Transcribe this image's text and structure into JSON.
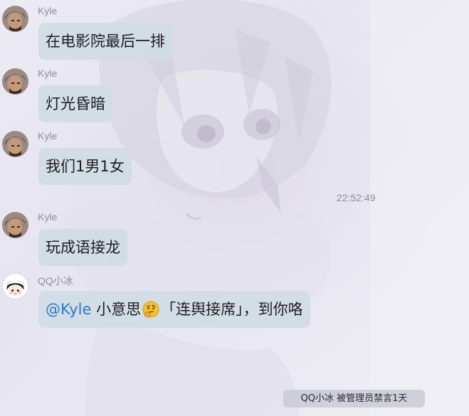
{
  "messages": [
    {
      "sender": "Kyle",
      "text": "在电影院最后一排"
    },
    {
      "sender": "Kyle",
      "text": "灯光昏暗"
    },
    {
      "sender": "Kyle",
      "text": "我们1男1女"
    },
    {
      "sender": "Kyle",
      "text": "玩成语接龙"
    },
    {
      "sender": "QQ小冰",
      "mention": "@Kyle",
      "text_before_emoji": " 小意思",
      "emoji": "thinking-face",
      "text_after_emoji": "「连舆接席」，到你咯"
    }
  ],
  "timestamp": "22:52:49",
  "system_notice": "QQ小冰 被管理员禁言1天",
  "colors": {
    "bubble": "#cfdbe4",
    "mention": "#2a7bc9",
    "sender": "#8f8d99"
  }
}
